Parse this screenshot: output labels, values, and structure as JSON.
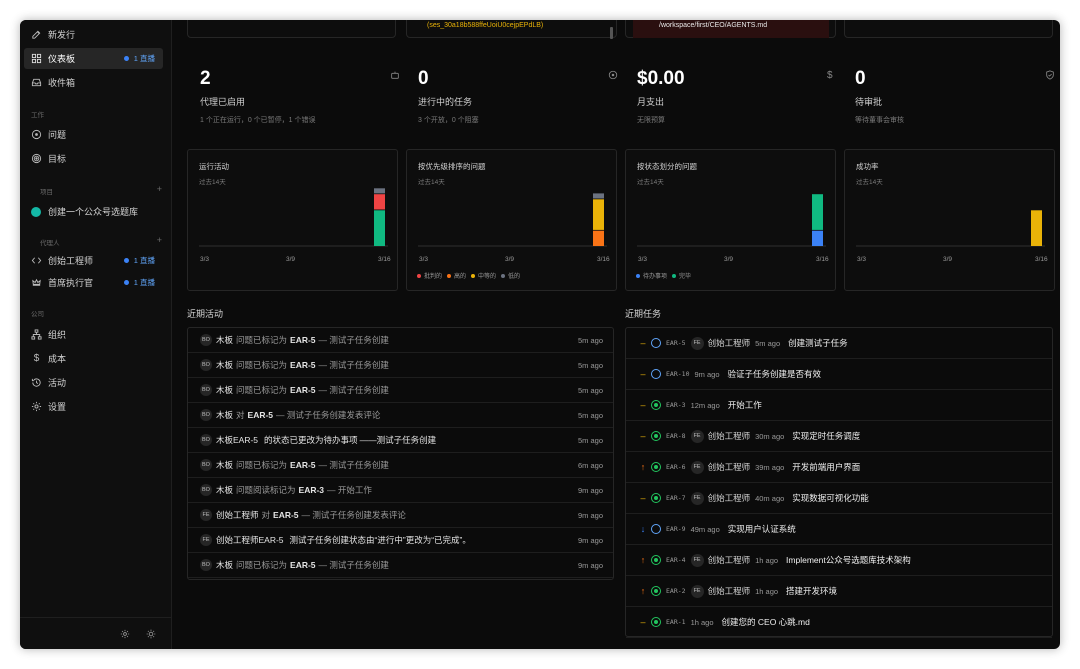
{
  "sidebar": {
    "new_issue": "新发行",
    "dashboard": "仪表板",
    "dashboard_badge": "1 直播",
    "inbox": "收件箱",
    "section_work": "工作",
    "issues": "问题",
    "goals": "目标",
    "section_projects": "项目",
    "project_1": "创建一个公众号选题库",
    "section_agents": "代理人",
    "agent_1": "创始工程师",
    "agent_1_badge": "1 直播",
    "agent_2": "首席执行官",
    "agent_2_badge": "1 直播",
    "section_company": "公司",
    "org": "组织",
    "costs": "成本",
    "activity": "活动",
    "settings": "设置"
  },
  "top_cards": {
    "session": "(ses_30a18b588ffeUoiU0cejpEPdLB)",
    "path": "/workspace/first/CEO/AGENTS.md"
  },
  "stats": [
    {
      "value": "2",
      "label": "代理已启用",
      "sub": "1 个正在运行，0 个已暂停，1 个错误",
      "icon": "bot-icon"
    },
    {
      "value": "0",
      "label": "进行中的任务",
      "sub": "3 个开放，0 个阻塞",
      "icon": "circle-dot-icon"
    },
    {
      "value": "$0.00",
      "label": "月支出",
      "sub": "无限预算",
      "icon": "dollar-icon"
    },
    {
      "value": "0",
      "label": "待审批",
      "sub": "等待董事会审核",
      "icon": "shield-icon"
    }
  ],
  "charts": {
    "subtitle": "过去14天",
    "x_ticks": [
      "3/3",
      "3/9",
      "3/16"
    ],
    "run_activity": {
      "title": "运行活动"
    },
    "priority": {
      "title": "按优先级排序的问题",
      "legend": [
        "批判的",
        "高的",
        "中等的",
        "低的"
      ]
    },
    "status": {
      "title": "按状态划分的问题",
      "legend": [
        "待办事项",
        "完毕"
      ]
    },
    "success": {
      "title": "成功率"
    }
  },
  "chart_data": [
    {
      "type": "bar",
      "title": "运行活动",
      "subtitle": "过去14天",
      "x_ticks": [
        "3/3",
        "3/9",
        "3/16"
      ],
      "categories": [
        "3/16"
      ],
      "series": [
        {
          "color": "#10b981",
          "values": [
            7
          ]
        },
        {
          "color": "#ef4444",
          "values": [
            3
          ]
        },
        {
          "color": "#6b7280",
          "values": [
            1
          ]
        }
      ],
      "grid": false
    },
    {
      "type": "bar",
      "title": "按优先级排序的问题",
      "subtitle": "过去14天",
      "x_ticks": [
        "3/3",
        "3/9",
        "3/16"
      ],
      "categories": [
        "3/16"
      ],
      "series": [
        {
          "name": "批判的",
          "color": "#ef4444",
          "values": [
            0
          ]
        },
        {
          "name": "高的",
          "color": "#f97316",
          "values": [
            3
          ]
        },
        {
          "name": "中等的",
          "color": "#eab308",
          "values": [
            6
          ]
        },
        {
          "name": "低的",
          "color": "#6b7280",
          "values": [
            1
          ]
        }
      ],
      "legend": "bottom-left"
    },
    {
      "type": "bar",
      "title": "按状态划分的问题",
      "subtitle": "过去14天",
      "x_ticks": [
        "3/3",
        "3/9",
        "3/16"
      ],
      "categories": [
        "3/16"
      ],
      "series": [
        {
          "name": "待办事项",
          "color": "#3b82f6",
          "values": [
            3
          ]
        },
        {
          "name": "完毕",
          "color": "#10b981",
          "values": [
            7
          ]
        }
      ],
      "legend": "bottom-left"
    },
    {
      "type": "bar",
      "title": "成功率",
      "subtitle": "过去14天",
      "x_ticks": [
        "3/3",
        "3/9",
        "3/16"
      ],
      "categories": [
        "3/16"
      ],
      "series": [
        {
          "color": "#eab308",
          "values": [
            7
          ]
        }
      ]
    }
  ],
  "recent_activity": {
    "title": "近期活动",
    "rows": [
      {
        "av": "BO",
        "actor": "木板",
        "verb": "问题已标记为",
        "ref": "EAR-5",
        "detail": "— 测试子任务创建",
        "ago": "5m ago"
      },
      {
        "av": "BO",
        "actor": "木板",
        "verb": "问题已标记为",
        "ref": "EAR-5",
        "detail": "— 测试子任务创建",
        "ago": "5m ago"
      },
      {
        "av": "BO",
        "actor": "木板",
        "verb": "问题已标记为",
        "ref": "EAR-5",
        "detail": "— 测试子任务创建",
        "ago": "5m ago"
      },
      {
        "av": "BO",
        "actor": "木板",
        "verb": "对",
        "ref": "EAR-5",
        "detail": "— 测试子任务创建发表评论",
        "ago": "5m ago"
      },
      {
        "av": "BO",
        "actor": "木板EAR-5",
        "verb": "的状态已更改为待办事项",
        "ref": "",
        "detail": "——测试子任务创建",
        "ago": "5m ago",
        "hl": true
      },
      {
        "av": "BO",
        "actor": "木板",
        "verb": "问题已标记为",
        "ref": "EAR-5",
        "detail": "— 测试子任务创建",
        "ago": "6m ago"
      },
      {
        "av": "BO",
        "actor": "木板",
        "verb": "问题阅读标记为",
        "ref": "EAR-3",
        "detail": "— 开始工作",
        "ago": "9m ago"
      },
      {
        "av": "FE",
        "actor": "创始工程师",
        "verb": "对",
        "ref": "EAR-5",
        "detail": "— 测试子任务创建发表评论",
        "ago": "9m ago"
      },
      {
        "av": "FE",
        "actor": "创始工程师EAR-5",
        "verb": "测试子任务创建状态由“进行中”更改为“已完成”。",
        "ref": "",
        "detail": "",
        "ago": "9m ago",
        "hl": true
      },
      {
        "av": "BO",
        "actor": "木板",
        "verb": "问题已标记为",
        "ref": "EAR-5",
        "detail": "— 测试子任务创建",
        "ago": "9m ago"
      }
    ]
  },
  "recent_tasks": {
    "title": "近期任务",
    "rows": [
      {
        "pri": "–",
        "pri_color": "#eab308",
        "status": "todo",
        "code": "EAR-5",
        "av": "FE",
        "assignee": "创始工程师",
        "ago": "5m ago",
        "title": "创建测试子任务"
      },
      {
        "pri": "–",
        "pri_color": "#eab308",
        "status": "todo",
        "code": "EAR-10",
        "av": "",
        "assignee": "",
        "ago": "9m ago",
        "title": "验证子任务创建是否有效"
      },
      {
        "pri": "–",
        "pri_color": "#eab308",
        "status": "done",
        "code": "EAR-3",
        "av": "",
        "assignee": "",
        "ago": "12m ago",
        "title": "开始工作"
      },
      {
        "pri": "–",
        "pri_color": "#eab308",
        "status": "done",
        "code": "EAR-8",
        "av": "FE",
        "assignee": "创始工程师",
        "ago": "30m ago",
        "title": "实现定时任务调度"
      },
      {
        "pri": "↑",
        "pri_color": "#f97316",
        "status": "done",
        "code": "EAR-6",
        "av": "FE",
        "assignee": "创始工程师",
        "ago": "39m ago",
        "title": "开发前端用户界面"
      },
      {
        "pri": "–",
        "pri_color": "#eab308",
        "status": "done",
        "code": "EAR-7",
        "av": "FE",
        "assignee": "创始工程师",
        "ago": "40m ago",
        "title": "实现数据可视化功能"
      },
      {
        "pri": "↓",
        "pri_color": "#3b82f6",
        "status": "todo",
        "code": "EAR-9",
        "av": "",
        "assignee": "",
        "ago": "49m ago",
        "title": "实现用户认证系统"
      },
      {
        "pri": "↑",
        "pri_color": "#f97316",
        "status": "done",
        "code": "EAR-4",
        "av": "FE",
        "assignee": "创始工程师",
        "ago": "1h ago",
        "title": "Implement公众号选题库技术架构"
      },
      {
        "pri": "↑",
        "pri_color": "#f97316",
        "status": "done",
        "code": "EAR-2",
        "av": "FE",
        "assignee": "创始工程师",
        "ago": "1h ago",
        "title": "搭建开发环境"
      },
      {
        "pri": "–",
        "pri_color": "#eab308",
        "status": "done",
        "code": "EAR-1",
        "av": "",
        "assignee": "",
        "ago": "1h ago",
        "title": "创建您的 CEO 心跳.md"
      }
    ]
  }
}
